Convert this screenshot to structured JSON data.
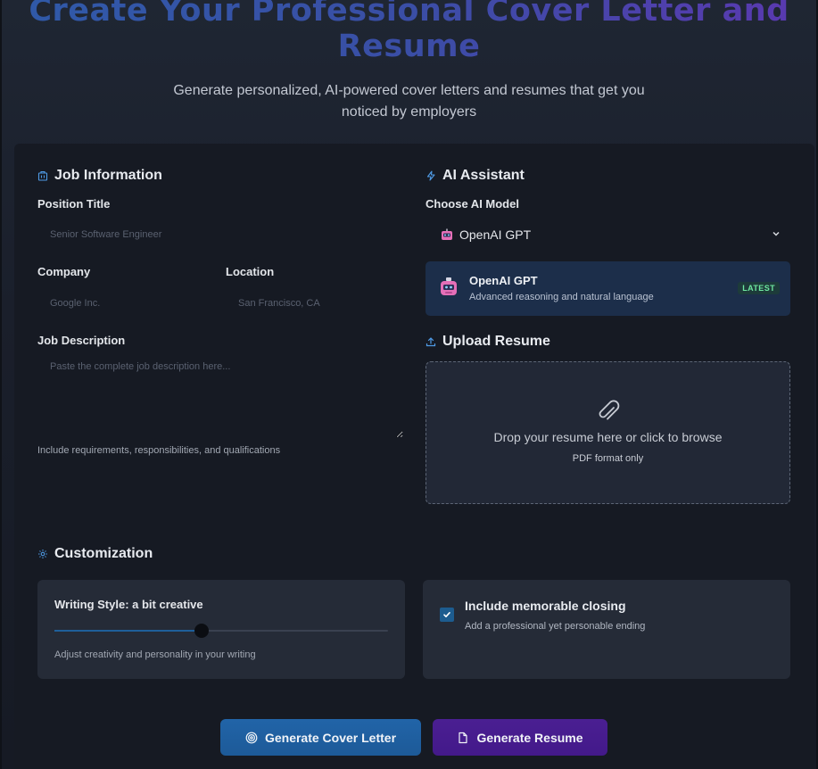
{
  "hero": {
    "title_line1": "Create Your Professional Cover Letter and",
    "title_line2": "Resume",
    "subtitle": "Generate personalized, AI-powered cover letters and resumes that get you noticed by employers"
  },
  "job": {
    "section_title": "Job Information",
    "position_label": "Position Title",
    "position_placeholder": "Senior Software Engineer",
    "company_label": "Company",
    "company_placeholder": "Google Inc.",
    "location_label": "Location",
    "location_placeholder": "San Francisco, CA",
    "description_label": "Job Description",
    "description_placeholder": "Paste the complete job description here...",
    "description_hint": "Include requirements, responsibilities, and qualifications"
  },
  "ai": {
    "section_title": "AI Assistant",
    "model_label": "Choose AI Model",
    "selected_model": "OpenAI GPT",
    "model_card": {
      "name": "OpenAI GPT",
      "description": "Advanced reasoning and natural language",
      "badge": "LATEST"
    }
  },
  "upload": {
    "section_title": "Upload Resume",
    "drop_title": "Drop your resume here or click to browse",
    "drop_subtitle": "PDF format only"
  },
  "customization": {
    "section_title": "Customization",
    "writing_style_label": "Writing Style: a bit creative",
    "writing_style_level": 0.44,
    "writing_style_hint": "Adjust creativity and personality in your writing",
    "closing_title": "Include memorable closing",
    "closing_subtitle": "Add a professional yet personable ending",
    "closing_checked": true
  },
  "actions": {
    "cover_letter_label": "Generate Cover Letter",
    "resume_label": "Generate Resume"
  },
  "colors": {
    "accent_blue": "#2164a8",
    "accent_purple": "#4a1f92",
    "badge_green": "#6ee7a0",
    "icon_blue": "#4f9be6"
  }
}
